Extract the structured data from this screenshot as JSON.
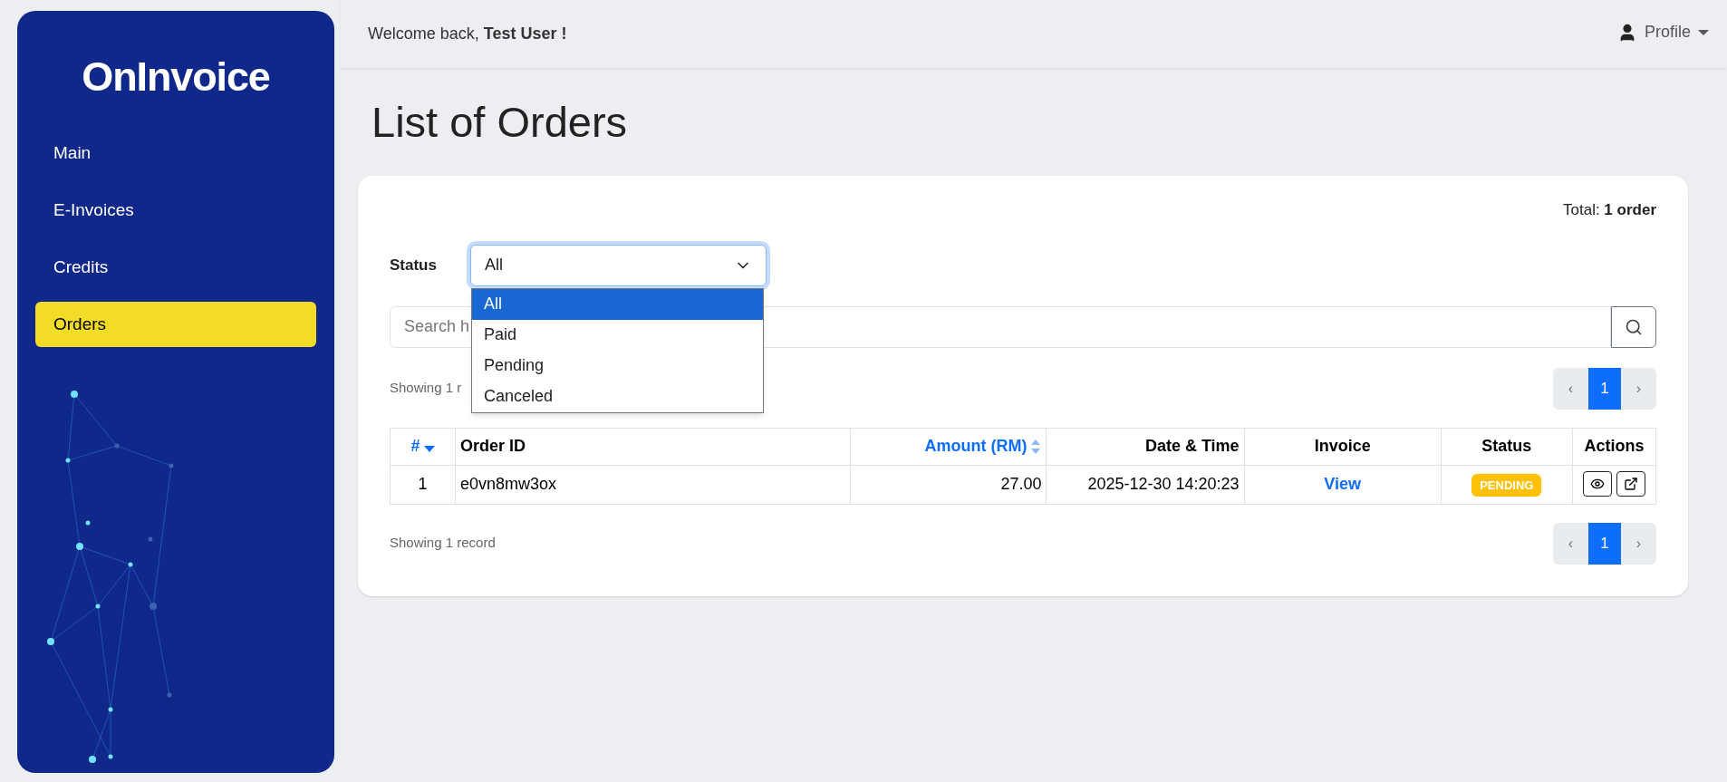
{
  "sidebar": {
    "logo": "OnInvoice",
    "items": [
      {
        "label": "Main",
        "selected": false
      },
      {
        "label": "E-Invoices",
        "selected": false
      },
      {
        "label": "Credits",
        "selected": false
      },
      {
        "label": "Orders",
        "selected": true
      }
    ]
  },
  "header": {
    "welcome": "Welcome back, **Test User !**",
    "profile": "Profile"
  },
  "page_title": "List of Orders",
  "total": "Total: **1 order**",
  "filter": {
    "label": "Status",
    "value": "All",
    "expanded": true,
    "options": [
      {
        "label": "All",
        "selected": true
      },
      {
        "label": "Paid",
        "selected": false
      },
      {
        "label": "Pending",
        "selected": false
      },
      {
        "label": "Canceled",
        "selected": false
      }
    ]
  },
  "search": {
    "placeholder": "Search h"
  },
  "showing_top": "Showing 1 r",
  "pagination_top": {
    "prev": "‹",
    "next": "›",
    "pages": [
      {
        "label": "1",
        "selected": true
      }
    ]
  },
  "table": {
    "columns": [
      {
        "label": "#",
        "sortable": true,
        "sorted": true
      },
      {
        "label": "Order ID"
      },
      {
        "label": "Amount (RM)",
        "sortable": true,
        "sorted": false
      },
      {
        "label": "Date & Time"
      },
      {
        "label": "Invoice"
      },
      {
        "label": "Status"
      },
      {
        "label": "Actions"
      }
    ],
    "rows": [
      {
        "index": "1",
        "order_id": "e0vn8mw3ox",
        "amount": "27.00",
        "date_time": "2025-12-30 14:20:23",
        "invoice": "View",
        "status": {
          "label": "PENDING",
          "color": "#ffc107"
        }
      }
    ]
  },
  "showing_bottom": "Showing 1 record",
  "pagination_bottom": {
    "prev": "‹",
    "next": "›",
    "pages": [
      {
        "label": "1",
        "selected": true
      }
    ]
  }
}
